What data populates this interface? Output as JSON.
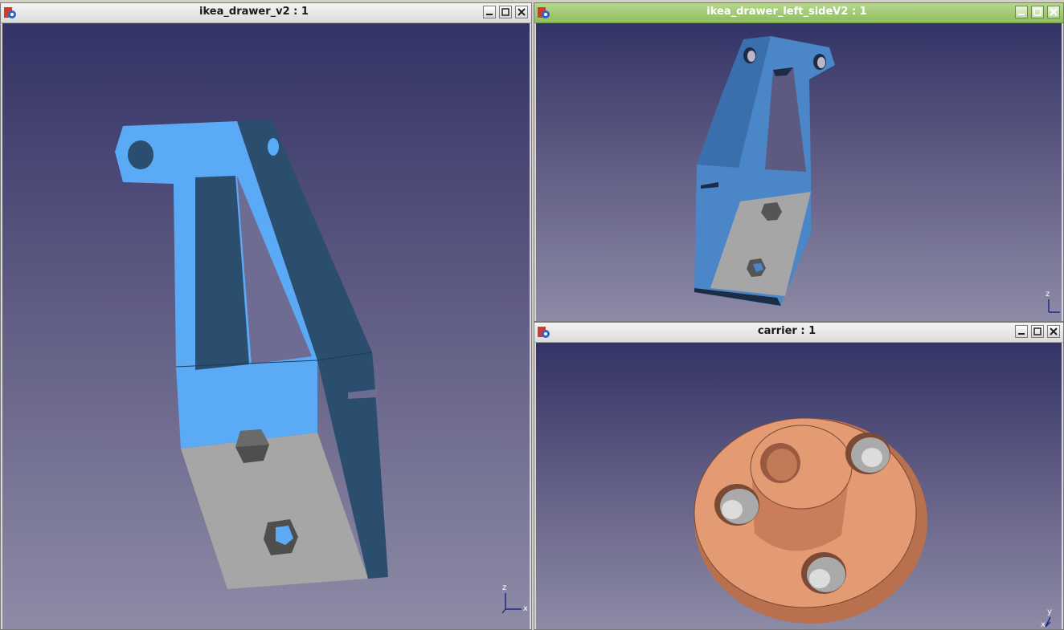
{
  "windows": [
    {
      "title": "ikea_drawer_v2 : 1",
      "active": false
    },
    {
      "title": "ikea_drawer_left_sideV2 : 1",
      "active": true
    },
    {
      "title": "carrier : 1",
      "active": false
    }
  ],
  "axis_labels": {
    "z": "z",
    "x": "x",
    "y": "y"
  },
  "colors": {
    "part_blue": "#5aaaf5",
    "part_dark": "#2b4d6e",
    "part_gray": "#a6a6a6",
    "carrier": "#e49a73",
    "active_titlebar": "#8fbd5f"
  },
  "icons": [
    "app-icon",
    "minimize-icon",
    "maximize-icon",
    "close-icon"
  ]
}
